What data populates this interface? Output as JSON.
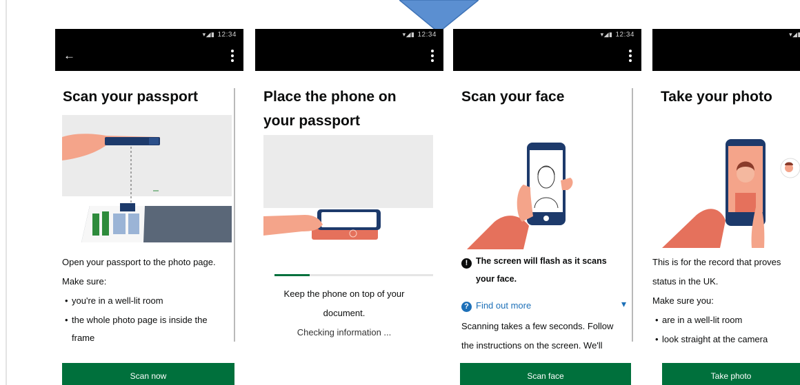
{
  "status_time": "12:34",
  "status_glyphs": "▾◢▮",
  "screens": [
    {
      "title": "Scan your passport",
      "intro": "Open your passport to the photo page.",
      "make_sure": "Make sure:",
      "bullets": [
        "you're in a well-lit room",
        "the whole photo page is inside the",
        "frame"
      ],
      "button": "Scan now"
    },
    {
      "title_line1": "Place the phone on",
      "title_line2": "your passport",
      "message_line1": "Keep the phone on top of your",
      "message_line2": "document.",
      "checking": "Checking information ...",
      "progress": 0.22
    },
    {
      "title": "Scan your face",
      "warning_line1": "The screen will flash as it scans",
      "warning_line2": "your face.",
      "find_out_more": "Find out more",
      "details_line1": "Scanning takes a few seconds. Follow",
      "details_line2": "the instructions on the screen. We'll",
      "button": "Scan face"
    },
    {
      "title": "Take your photo",
      "intro_line1": "This is for the record that proves",
      "intro_line2": "status in the UK.",
      "make_sure": "Make sure you:",
      "bullets": [
        "are in a well-lit room",
        "look straight at the camera"
      ],
      "button": "Take photo"
    }
  ],
  "colors": {
    "status_bar": "#000000",
    "button_green": "#00703c",
    "link_blue": "#1d70b8",
    "pointer_blue": "#5b8fd1",
    "skin": "#f4a48a",
    "skin_dark": "#e5715c",
    "phone_navy": "#1d3a6b"
  }
}
